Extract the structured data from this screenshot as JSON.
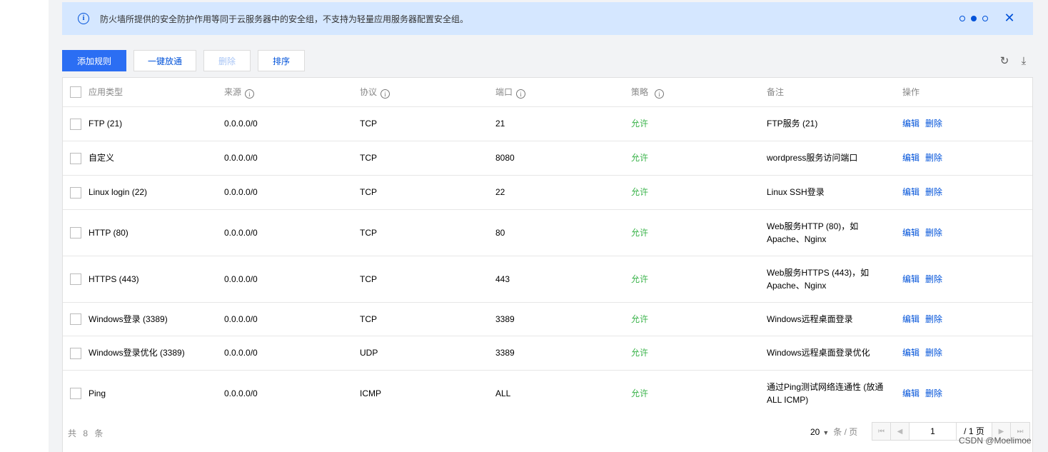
{
  "notice": {
    "message": "防火墙所提供的安全防护作用等同于云服务器中的安全组，不支持为轻量应用服务器配置安全组。",
    "info_glyph": "i",
    "close_glyph": "✕",
    "accent": "#0052d9"
  },
  "toolbar": {
    "add_rule": "添加规则",
    "one_click_open": "一键放通",
    "delete": "删除",
    "sort": "排序",
    "refresh_glyph": "↻",
    "download_glyph": "⤓"
  },
  "table": {
    "columns": [
      "应用类型",
      "来源",
      "协议",
      "端口",
      "策略",
      "备注",
      "操作"
    ],
    "actions": {
      "edit": "编辑",
      "delete": "删除"
    },
    "rows": [
      {
        "app": "FTP (21)",
        "source": "0.0.0.0/0",
        "protocol": "TCP",
        "port": "21",
        "policy": "允许",
        "remark1": "FTP服务 (21)",
        "remark2": ""
      },
      {
        "app": "自定义",
        "source": "0.0.0.0/0",
        "protocol": "TCP",
        "port": "8080",
        "policy": "允许",
        "remark1": "wordpress服务访问端口",
        "remark2": ""
      },
      {
        "app": "Linux login (22)",
        "source": "0.0.0.0/0",
        "protocol": "TCP",
        "port": "22",
        "policy": "允许",
        "remark1": "Linux SSH登录",
        "remark2": ""
      },
      {
        "app": "HTTP (80)",
        "source": "0.0.0.0/0",
        "protocol": "TCP",
        "port": "80",
        "policy": "允许",
        "remark1": "Web服务HTTP (80)，如",
        "remark2": "Apache、Nginx"
      },
      {
        "app": "HTTPS (443)",
        "source": "0.0.0.0/0",
        "protocol": "TCP",
        "port": "443",
        "policy": "允许",
        "remark1": "Web服务HTTPS (443)，如",
        "remark2": "Apache、Nginx"
      },
      {
        "app": "Windows登录 (3389)",
        "source": "0.0.0.0/0",
        "protocol": "TCP",
        "port": "3389",
        "policy": "允许",
        "remark1": "Windows远程桌面登录",
        "remark2": ""
      },
      {
        "app": "Windows登录优化 (3389)",
        "source": "0.0.0.0/0",
        "protocol": "UDP",
        "port": "3389",
        "policy": "允许",
        "remark1": "Windows远程桌面登录优化",
        "remark2": ""
      },
      {
        "app": "Ping",
        "source": "0.0.0.0/0",
        "protocol": "ICMP",
        "port": "ALL",
        "policy": "允许",
        "remark1": "通过Ping测试网络连通性 (放通",
        "remark2": "ALL ICMP)"
      }
    ]
  },
  "footer": {
    "total": "共 8 条",
    "page_size": "20",
    "page_size_unit": "条 / 页",
    "current_page": "1",
    "total_pages": "/ 1 页"
  },
  "watermark": "CSDN @Moelimoe",
  "colors": {
    "primary": "#2b6ef3",
    "allow": "#3ab34a",
    "link": "#0052d9"
  }
}
